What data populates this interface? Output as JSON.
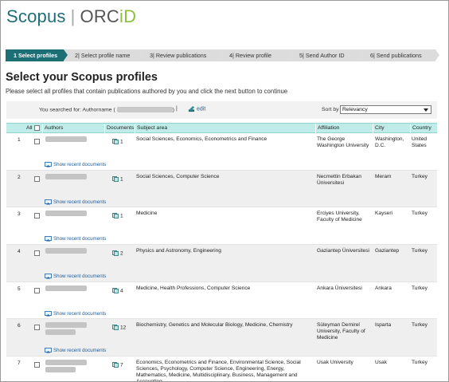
{
  "brand": {
    "scopus": "Scopus",
    "orcid_prefix": "ORC",
    "orcid_suffix": "iD",
    "separator": "|"
  },
  "wizard": {
    "steps": [
      {
        "label": "1 Select profiles",
        "active": true
      },
      {
        "label": "2| Select profile name",
        "active": false
      },
      {
        "label": "3| Review publications",
        "active": false
      },
      {
        "label": "4| Review profile",
        "active": false
      },
      {
        "label": "5| Send Author ID",
        "active": false
      },
      {
        "label": "6| Send publications",
        "active": false
      }
    ]
  },
  "page_title": "Select your Scopus profiles",
  "instruction": "Please select all profiles that contain publications authored by you and click the next button to continue",
  "search": {
    "searched_prefix": "You searched for: Authorname (",
    "searched_suffix": ")",
    "divider": "|",
    "edit_label": "edit",
    "sort_label": "Sort by",
    "sort_value": "Relevancy"
  },
  "table": {
    "headers": {
      "all": "All",
      "authors": "Authors",
      "documents": "Documents",
      "subject": "Subject area",
      "affiliation": "Affiliation",
      "city": "City",
      "country": "Country"
    },
    "show_recent_label": "Show recent documents",
    "rows": [
      {
        "num": "1",
        "documents": "1",
        "subject": "Social Sciences, Economics, Econometrics and Finance",
        "affiliation": "The George Washington University",
        "city": "Washington, D.C.",
        "country": "United States",
        "author_lines": 1
      },
      {
        "num": "2",
        "documents": "1",
        "subject": "Social Sciences, Computer Science",
        "affiliation": "Necmettin Erbakan Üniversitesi",
        "city": "Meram",
        "country": "Turkey",
        "author_lines": 1
      },
      {
        "num": "3",
        "documents": "1",
        "subject": "Medicine",
        "affiliation": "Erciyes University, Faculty of Medicine",
        "city": "Kayseri",
        "country": "Turkey",
        "author_lines": 1
      },
      {
        "num": "4",
        "documents": "2",
        "subject": "Physics and Astronomy, Engineering",
        "affiliation": "Gaziantep Üniversitesi",
        "city": "Gaziantep",
        "country": "Turkey",
        "author_lines": 1
      },
      {
        "num": "5",
        "documents": "4",
        "subject": "Medicine, Health Professions, Computer Science",
        "affiliation": "Ankara Üniversitesi",
        "city": "Ankara",
        "country": "Turkey",
        "author_lines": 1
      },
      {
        "num": "6",
        "documents": "12",
        "subject": "Biochemistry, Genetics and Molecular Biology, Medicine, Chemistry",
        "affiliation": "Süleyman Demirel University, Faculty of Medicine",
        "city": "Isparta",
        "country": "Turkey",
        "author_lines": 2
      },
      {
        "num": "7",
        "documents": "7",
        "subject": "Economics, Econometrics and Finance, Environmental Science, Social Sciences, Psychology, Computer Science, Engineering, Energy, Mathematics, Medicine, Multidisciplinary, Business, Management and Accounting",
        "affiliation": "Usak University",
        "city": "Usak",
        "country": "Turkey",
        "author_lines": 2
      }
    ]
  },
  "colors": {
    "brand_teal": "#1d6f76",
    "header_row": "#bfece9",
    "link": "#1a5fa8",
    "orcid_green": "#8bbf3c"
  }
}
